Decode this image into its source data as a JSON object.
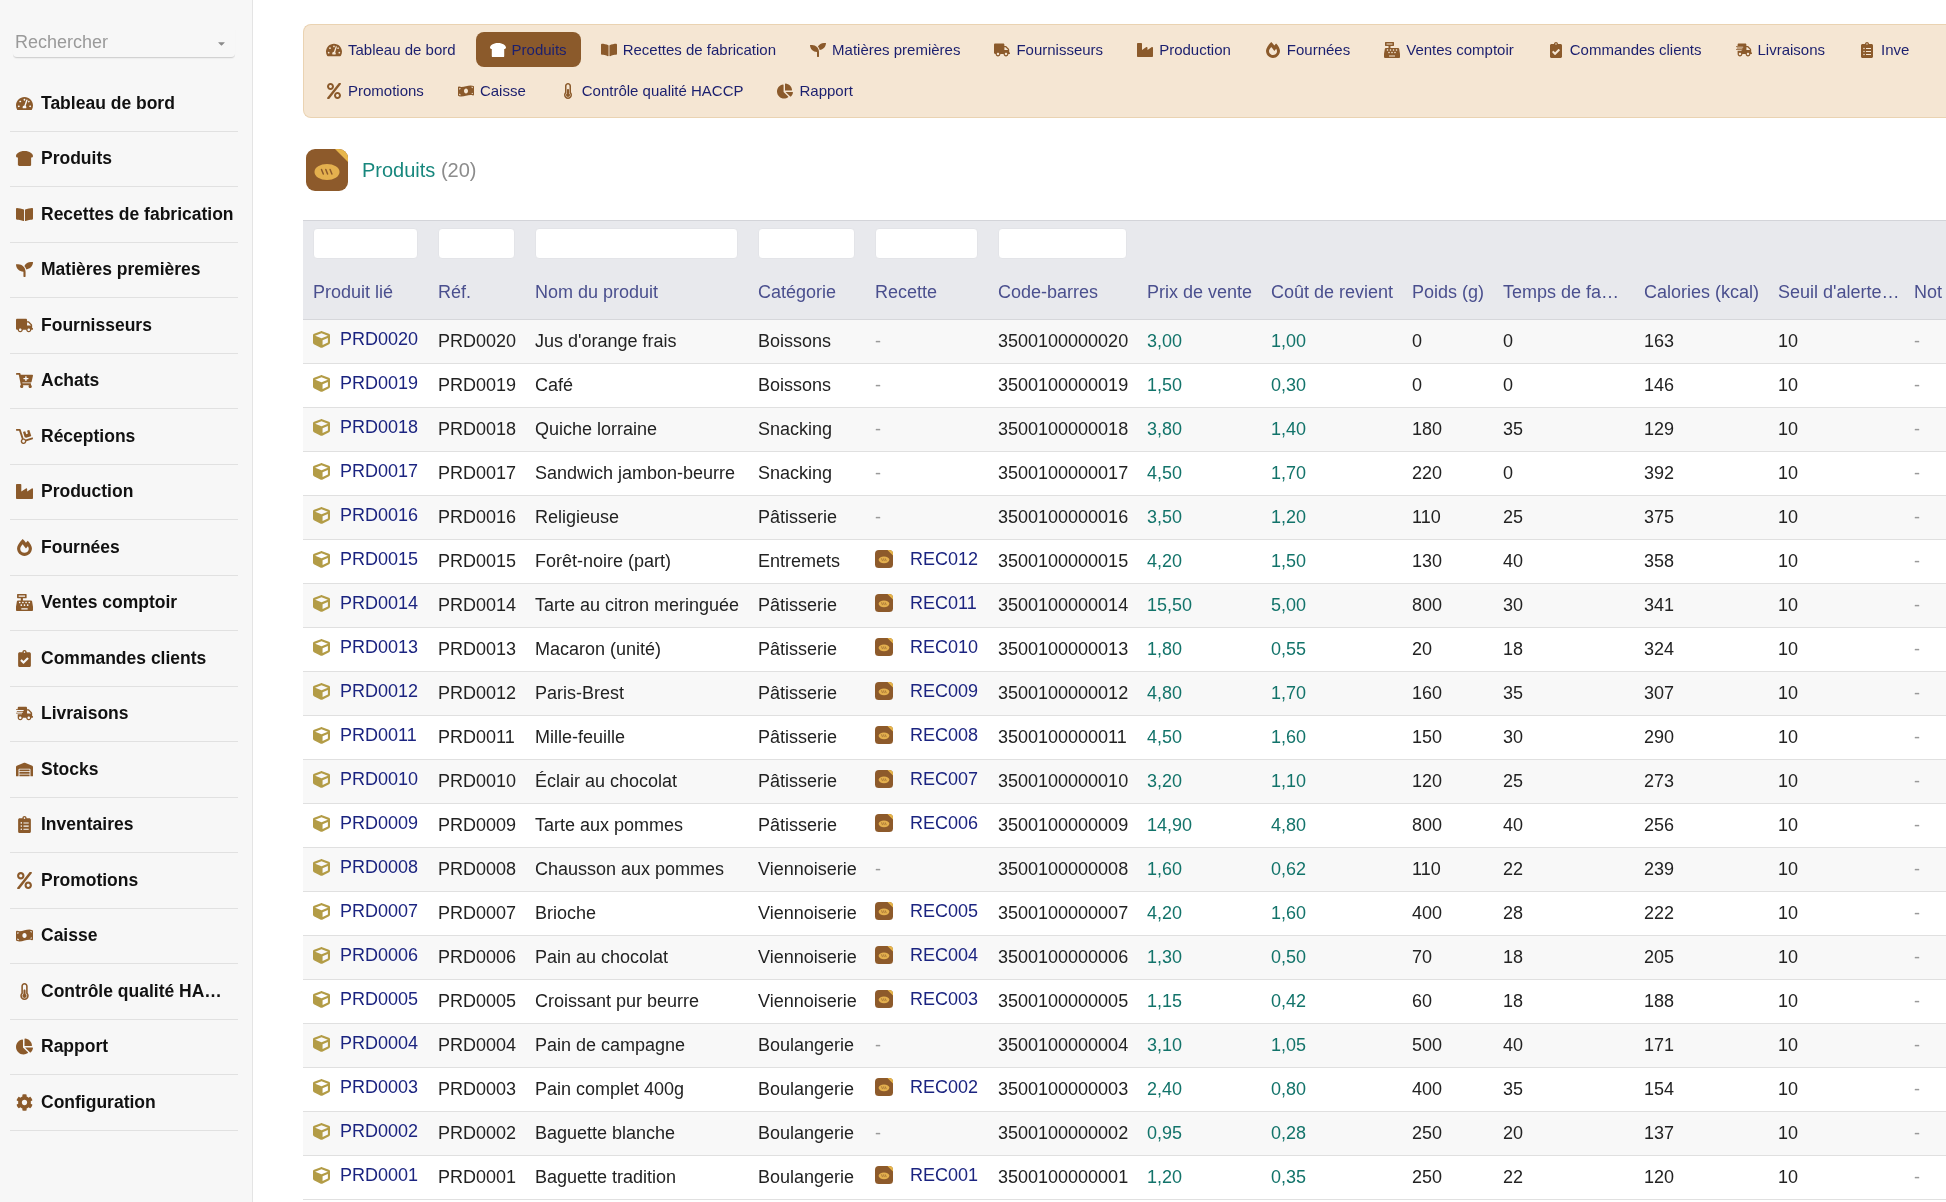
{
  "sidebar": {
    "search": {
      "placeholder": "Rechercher"
    },
    "items": [
      {
        "label": "Tableau de bord",
        "kind": "dashboard"
      },
      {
        "label": "Produits",
        "kind": "products"
      },
      {
        "label": "Recettes de fabrication",
        "kind": "recipes"
      },
      {
        "label": "Matières premières",
        "kind": "materials"
      },
      {
        "label": "Fournisseurs",
        "kind": "suppliers"
      },
      {
        "label": "Achats",
        "kind": "purchases"
      },
      {
        "label": "Réceptions",
        "kind": "receptions"
      },
      {
        "label": "Production",
        "kind": "production"
      },
      {
        "label": "Fournées",
        "kind": "batches"
      },
      {
        "label": "Ventes comptoir",
        "kind": "sales"
      },
      {
        "label": "Commandes clients",
        "kind": "orders"
      },
      {
        "label": "Livraisons",
        "kind": "deliveries"
      },
      {
        "label": "Stocks",
        "kind": "stock"
      },
      {
        "label": "Inventaires",
        "kind": "inventory"
      },
      {
        "label": "Promotions",
        "kind": "promotions"
      },
      {
        "label": "Caisse",
        "kind": "cash"
      },
      {
        "label": "Contrôle qualité HA…",
        "kind": "quality"
      },
      {
        "label": "Rapport",
        "kind": "report"
      },
      {
        "label": "Configuration",
        "kind": "settings"
      }
    ]
  },
  "tab_bar": {
    "rows": [
      {
        "tabs": [
          {
            "label": "Tableau de bord",
            "kind": "dashboard",
            "selected": false
          },
          {
            "label": "Produits",
            "kind": "products",
            "selected": true
          },
          {
            "label": "Recettes de fabrication",
            "kind": "recipes",
            "selected": false
          },
          {
            "label": "Matières premières",
            "kind": "materials",
            "selected": false
          },
          {
            "label": "Fournisseurs",
            "kind": "suppliers",
            "selected": false
          },
          {
            "label": "Production",
            "kind": "production",
            "selected": false
          },
          {
            "label": "Fournées",
            "kind": "batches",
            "selected": false
          },
          {
            "label": "Ventes comptoir",
            "kind": "sales",
            "selected": false
          },
          {
            "label": "Commandes clients",
            "kind": "orders",
            "selected": false
          },
          {
            "label": "Livraisons",
            "kind": "deliveries",
            "selected": false
          },
          {
            "label": "Inve",
            "kind": "inventory",
            "selected": false
          }
        ]
      },
      {
        "tabs": [
          {
            "label": "Promotions",
            "kind": "promotions",
            "selected": false
          },
          {
            "label": "Caisse",
            "kind": "cash",
            "selected": false
          },
          {
            "label": "Contrôle qualité HACCP",
            "kind": "quality",
            "selected": false
          },
          {
            "label": "Rapport",
            "kind": "report",
            "selected": false
          }
        ]
      }
    ]
  },
  "heading": {
    "title": "Produits",
    "count": "(20)"
  },
  "table": {
    "columns": [
      {
        "label": "Produit lié",
        "kind": "product",
        "filter": true
      },
      {
        "label": "Réf.",
        "kind": "text",
        "filter": true
      },
      {
        "label": "Nom du produit",
        "kind": "text",
        "filter": true
      },
      {
        "label": "Catégorie",
        "kind": "text",
        "filter": true
      },
      {
        "label": "Recette",
        "kind": "recipe",
        "filter": true
      },
      {
        "label": "Code-barres",
        "kind": "text",
        "filter": true
      },
      {
        "label": "Prix de vente",
        "kind": "money",
        "filter": false
      },
      {
        "label": "Coût de revient",
        "kind": "money",
        "filter": false
      },
      {
        "label": "Poids (g)",
        "kind": "text",
        "filter": false
      },
      {
        "label": "Temps de fa…",
        "kind": "text",
        "filter": false
      },
      {
        "label": "Calories (kcal)",
        "kind": "text",
        "filter": false
      },
      {
        "label": "Seuil d'alerte…",
        "kind": "text",
        "filter": false
      },
      {
        "label": "Not",
        "kind": "muted",
        "filter": false
      }
    ],
    "rows": [
      {
        "kind": "plain",
        "cells": [
          "PRD0020",
          "PRD0020",
          "Jus d'orange frais",
          "Boissons",
          "-",
          "3500100000020",
          "3,00",
          "1,00",
          "0",
          "0",
          "163",
          "10",
          "-"
        ]
      },
      {
        "kind": "plain",
        "cells": [
          "PRD0019",
          "PRD0019",
          "Café",
          "Boissons",
          "-",
          "3500100000019",
          "1,50",
          "0,30",
          "0",
          "0",
          "146",
          "10",
          "-"
        ]
      },
      {
        "kind": "plain",
        "cells": [
          "PRD0018",
          "PRD0018",
          "Quiche lorraine",
          "Snacking",
          "-",
          "3500100000018",
          "3,80",
          "1,40",
          "180",
          "35",
          "129",
          "10",
          "-"
        ]
      },
      {
        "kind": "plain",
        "cells": [
          "PRD0017",
          "PRD0017",
          "Sandwich jambon-beurre",
          "Snacking",
          "-",
          "3500100000017",
          "4,50",
          "1,70",
          "220",
          "0",
          "392",
          "10",
          "-"
        ]
      },
      {
        "kind": "plain",
        "cells": [
          "PRD0016",
          "PRD0016",
          "Religieuse",
          "Pâtisserie",
          "-",
          "3500100000016",
          "3,50",
          "1,20",
          "110",
          "25",
          "375",
          "10",
          "-"
        ]
      },
      {
        "kind": "recipe",
        "cells": [
          "PRD0015",
          "PRD0015",
          "Forêt-noire (part)",
          "Entremets",
          "REC012",
          "3500100000015",
          "4,20",
          "1,50",
          "130",
          "40",
          "358",
          "10",
          "-"
        ]
      },
      {
        "kind": "recipe",
        "cells": [
          "PRD0014",
          "PRD0014",
          "Tarte au citron meringuée",
          "Pâtisserie",
          "REC011",
          "3500100000014",
          "15,50",
          "5,00",
          "800",
          "30",
          "341",
          "10",
          "-"
        ]
      },
      {
        "kind": "recipe",
        "cells": [
          "PRD0013",
          "PRD0013",
          "Macaron (unité)",
          "Pâtisserie",
          "REC010",
          "3500100000013",
          "1,80",
          "0,55",
          "20",
          "18",
          "324",
          "10",
          "-"
        ]
      },
      {
        "kind": "recipe",
        "cells": [
          "PRD0012",
          "PRD0012",
          "Paris-Brest",
          "Pâtisserie",
          "REC009",
          "3500100000012",
          "4,80",
          "1,70",
          "160",
          "35",
          "307",
          "10",
          "-"
        ]
      },
      {
        "kind": "recipe",
        "cells": [
          "PRD0011",
          "PRD0011",
          "Mille-feuille",
          "Pâtisserie",
          "REC008",
          "3500100000011",
          "4,50",
          "1,60",
          "150",
          "30",
          "290",
          "10",
          "-"
        ]
      },
      {
        "kind": "recipe",
        "cells": [
          "PRD0010",
          "PRD0010",
          "Éclair au chocolat",
          "Pâtisserie",
          "REC007",
          "3500100000010",
          "3,20",
          "1,10",
          "120",
          "25",
          "273",
          "10",
          "-"
        ]
      },
      {
        "kind": "recipe",
        "cells": [
          "PRD0009",
          "PRD0009",
          "Tarte aux pommes",
          "Pâtisserie",
          "REC006",
          "3500100000009",
          "14,90",
          "4,80",
          "800",
          "40",
          "256",
          "10",
          "-"
        ]
      },
      {
        "kind": "plain",
        "cells": [
          "PRD0008",
          "PRD0008",
          "Chausson aux pommes",
          "Viennoiserie",
          "-",
          "3500100000008",
          "1,60",
          "0,62",
          "110",
          "22",
          "239",
          "10",
          "-"
        ]
      },
      {
        "kind": "recipe",
        "cells": [
          "PRD0007",
          "PRD0007",
          "Brioche",
          "Viennoiserie",
          "REC005",
          "3500100000007",
          "4,20",
          "1,60",
          "400",
          "28",
          "222",
          "10",
          "-"
        ]
      },
      {
        "kind": "recipe",
        "cells": [
          "PRD0006",
          "PRD0006",
          "Pain au chocolat",
          "Viennoiserie",
          "REC004",
          "3500100000006",
          "1,30",
          "0,50",
          "70",
          "18",
          "205",
          "10",
          "-"
        ]
      },
      {
        "kind": "recipe",
        "cells": [
          "PRD0005",
          "PRD0005",
          "Croissant pur beurre",
          "Viennoiserie",
          "REC003",
          "3500100000005",
          "1,15",
          "0,42",
          "60",
          "18",
          "188",
          "10",
          "-"
        ]
      },
      {
        "kind": "plain",
        "cells": [
          "PRD0004",
          "PRD0004",
          "Pain de campagne",
          "Boulangerie",
          "-",
          "3500100000004",
          "3,10",
          "1,05",
          "500",
          "40",
          "171",
          "10",
          "-"
        ]
      },
      {
        "kind": "recipe",
        "cells": [
          "PRD0003",
          "PRD0003",
          "Pain complet 400g",
          "Boulangerie",
          "REC002",
          "3500100000003",
          "2,40",
          "0,80",
          "400",
          "35",
          "154",
          "10",
          "-"
        ]
      },
      {
        "kind": "plain",
        "cells": [
          "PRD0002",
          "PRD0002",
          "Baguette blanche",
          "Boulangerie",
          "-",
          "3500100000002",
          "0,95",
          "0,28",
          "250",
          "20",
          "137",
          "10",
          "-"
        ]
      },
      {
        "kind": "recipe",
        "cells": [
          "PRD0001",
          "PRD0001",
          "Baguette tradition",
          "Boulangerie",
          "REC001",
          "3500100000001",
          "1,20",
          "0,35",
          "250",
          "22",
          "120",
          "10",
          "-"
        ]
      }
    ]
  }
}
